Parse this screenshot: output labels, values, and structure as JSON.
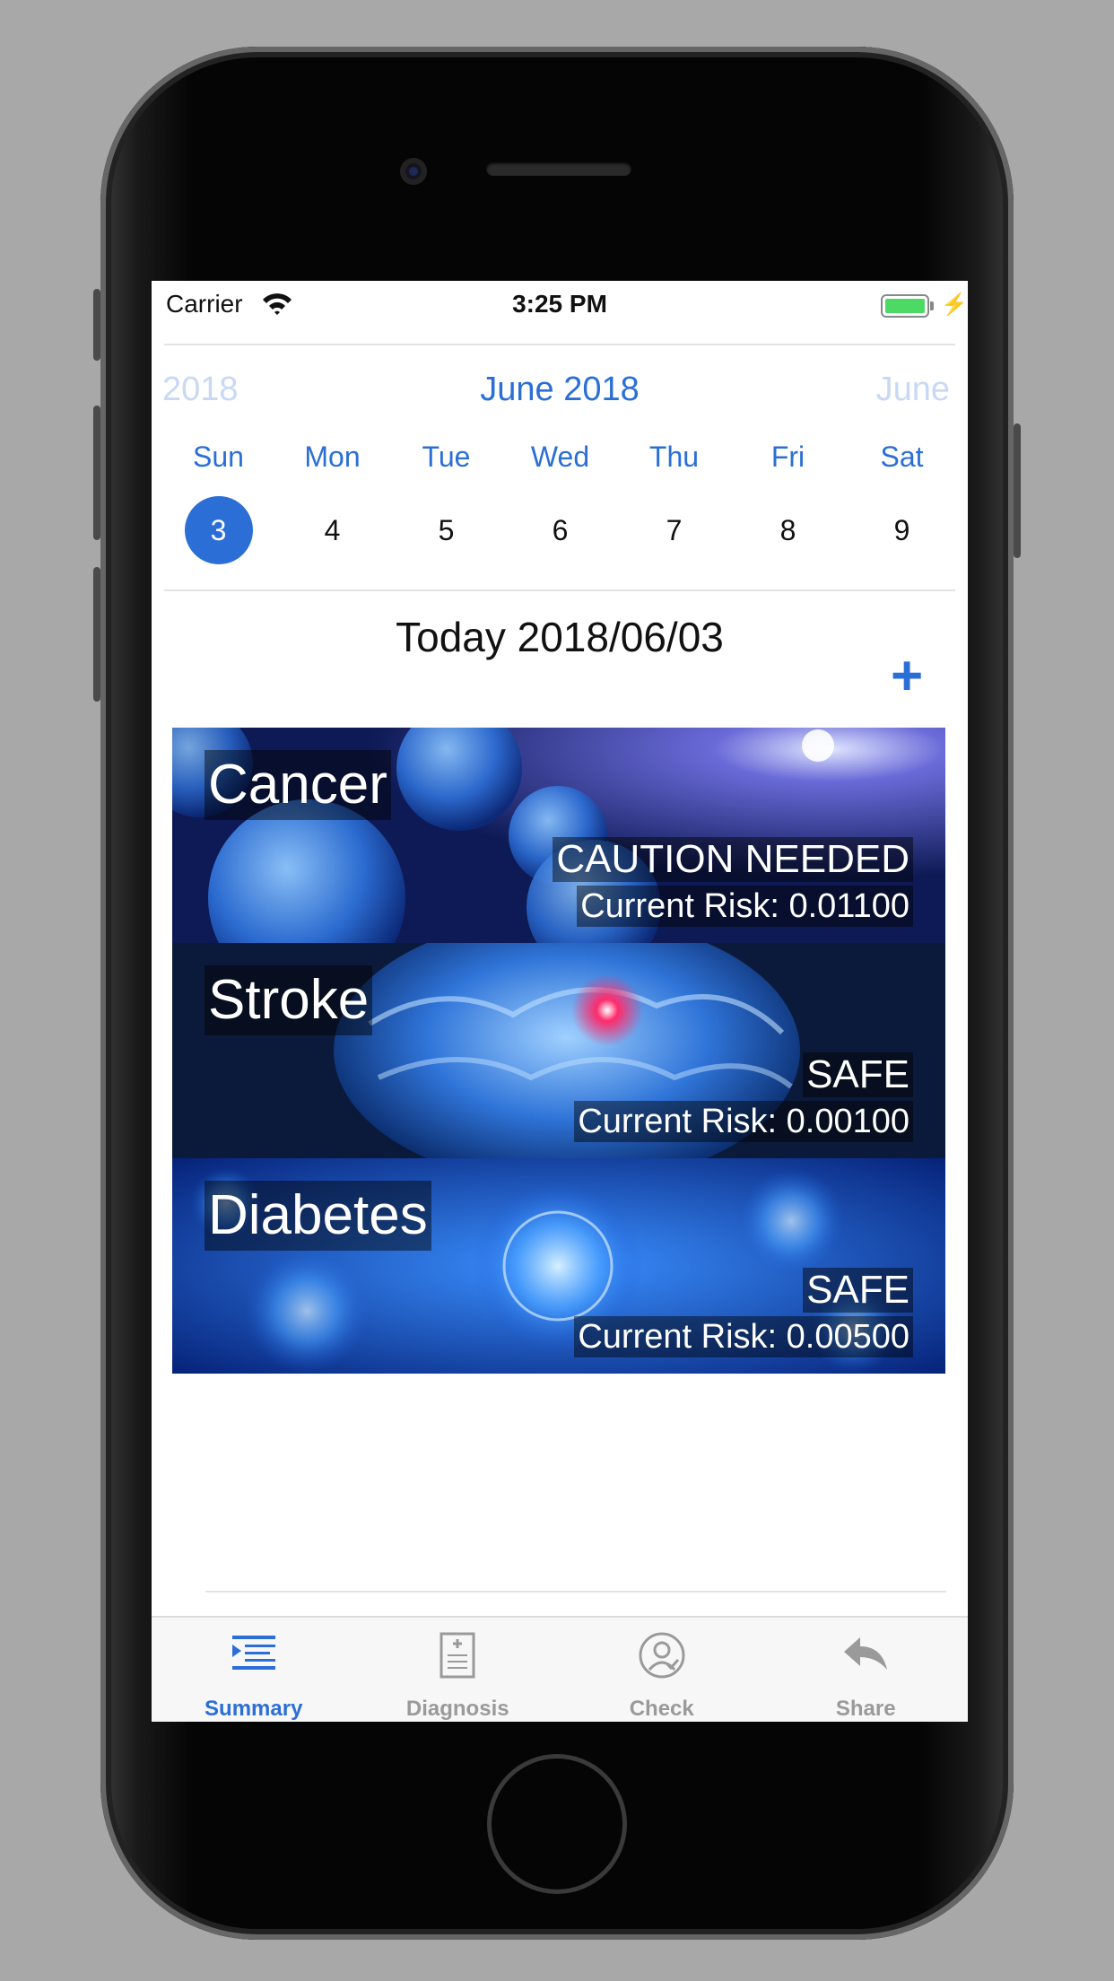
{
  "status_bar": {
    "carrier": "Carrier",
    "time": "3:25 PM"
  },
  "calendar": {
    "prev_label": "2018",
    "current_month": "June 2018",
    "next_label": "June",
    "weekdays": [
      "Sun",
      "Mon",
      "Tue",
      "Wed",
      "Thu",
      "Fri",
      "Sat"
    ],
    "days": [
      "3",
      "4",
      "5",
      "6",
      "7",
      "8",
      "9"
    ],
    "selected_day": "3"
  },
  "today_label": "Today 2018/06/03",
  "add_label": "+",
  "cards": [
    {
      "name": "Cancer",
      "status": "CAUTION NEEDED",
      "risk": "Current Risk: 0.01100"
    },
    {
      "name": "Stroke",
      "status": "SAFE",
      "risk": "Current Risk: 0.00100"
    },
    {
      "name": "Diabetes",
      "status": "SAFE",
      "risk": "Current Risk: 0.00500"
    }
  ],
  "tabs": [
    {
      "label": "Summary",
      "icon": "summary-list-icon"
    },
    {
      "label": "Diagnosis",
      "icon": "clipboard-icon"
    },
    {
      "label": "Check",
      "icon": "person-check-icon"
    },
    {
      "label": "Share",
      "icon": "reply-arrow-icon"
    }
  ],
  "colors": {
    "accent": "#2b6fd6",
    "inactive": "#9a9a9a",
    "battery": "#4cd964"
  }
}
